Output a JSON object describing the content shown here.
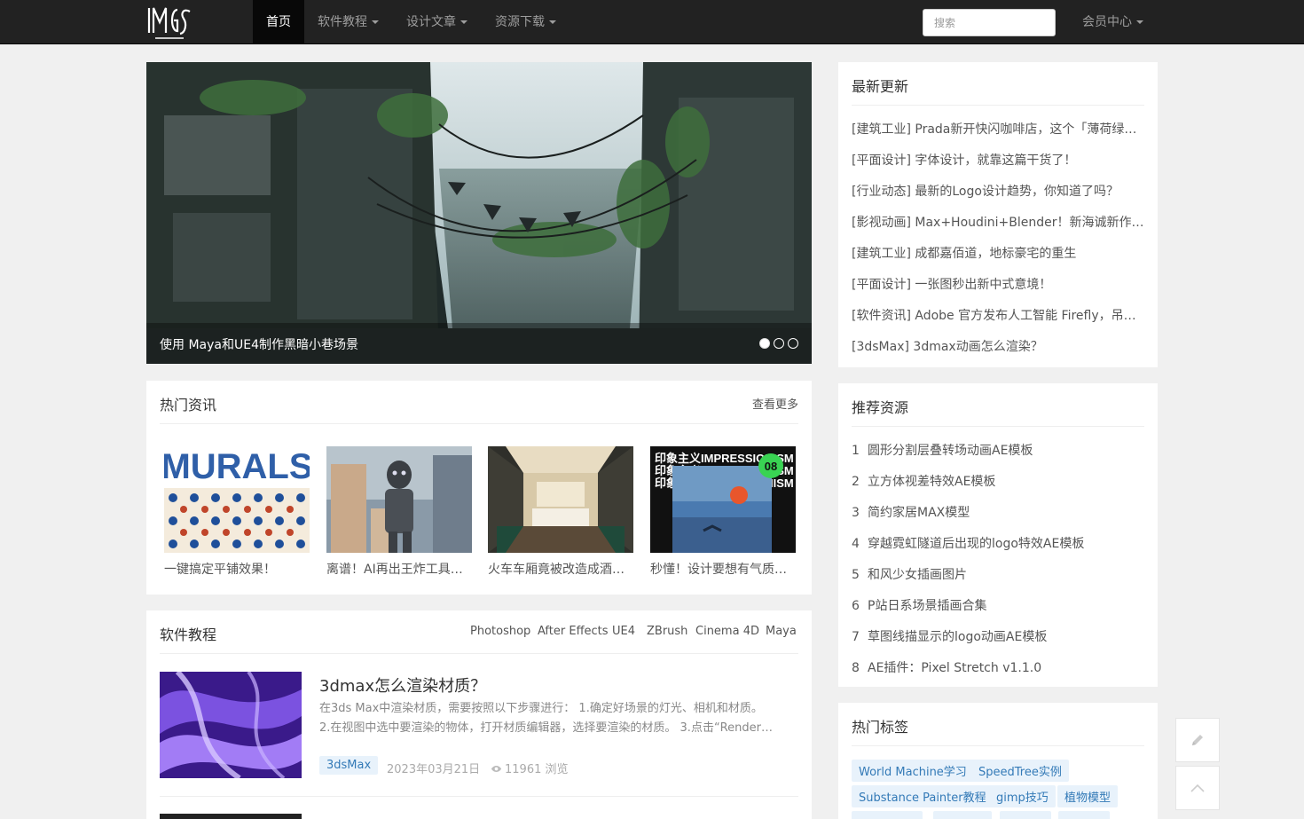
{
  "navbar": {
    "logo_text": "IMG",
    "items": [
      {
        "label": "首页",
        "dropdown": false,
        "active": true
      },
      {
        "label": "软件教程",
        "dropdown": true,
        "active": false
      },
      {
        "label": "设计文章",
        "dropdown": true,
        "active": false
      },
      {
        "label": "资源下载",
        "dropdown": true,
        "active": false
      }
    ],
    "search_placeholder": "搜索",
    "member_label": "会员中心"
  },
  "slider": {
    "caption": "使用 Maya和UE4制作黑暗小巷场景",
    "dots": 3,
    "active_dot": 0
  },
  "hot_news": {
    "title": "热门资讯",
    "more_label": "查看更多",
    "cards": [
      {
        "caption": "一键搞定平铺效果！",
        "thumb_text": "MURALS"
      },
      {
        "caption": "离谱！AI再出王炸工具…"
      },
      {
        "caption": "火车车厢竟被改造成酒…"
      },
      {
        "caption": "秒懂！设计要想有气质…",
        "thumb_text": "印象主义IMPRESSIONISM",
        "badge": "08"
      }
    ]
  },
  "software": {
    "title": "软件教程",
    "tabs": [
      "Photoshop",
      "After Effects",
      "UE4",
      "ZBrush",
      "Cinema 4D",
      "Maya"
    ],
    "article": {
      "title": "3dmax怎么渲染材质？",
      "excerpt_line1": "在3ds Max中渲染材质，需要按照以下步骤进行： 1.确定好场景的灯光、相机和材质。",
      "excerpt_line2": "2.在视图中选中要渲染的物体，打开材质编辑器，选择要渲染的材质。 3.点击“Render…",
      "tag": "3dsMax",
      "date": "2023年03月21日",
      "views": "11961 浏览"
    }
  },
  "latest": {
    "title": "最新更新",
    "items": [
      "[建筑工业] Prada新开快闪咖啡店，这个「薄荷绿」…",
      "[平面设计] 字体设计，就靠这篇干货了！",
      "[行业动态] 最新的Logo设计趋势，你知道了吗？",
      "[影视动画] Max+Houdini+Blender！新海诚新作《…",
      "[建筑工业] 成都嘉佰道，地标豪宅的重生",
      "[平面设计] 一张图秒出新中式意境！",
      "[软件资讯] Adobe 官方发布人工智能 Firefly，吊打…",
      "[3dsMax] 3dmax动画怎么渲染？"
    ]
  },
  "recommended": {
    "title": "推荐资源",
    "items": [
      {
        "rank": "1",
        "label": "圆形分割层叠转场动画AE模板"
      },
      {
        "rank": "2",
        "label": "立方体视差特效AE模板"
      },
      {
        "rank": "3",
        "label": "简约家居MAX模型"
      },
      {
        "rank": "4",
        "label": "穿越霓虹隧道后出现的logo特效AE模板"
      },
      {
        "rank": "5",
        "label": "和风少女插画图片"
      },
      {
        "rank": "6",
        "label": "P站日系场景插画合集"
      },
      {
        "rank": "7",
        "label": "草图线描显示的logo动画AE模板"
      },
      {
        "rank": "8",
        "label": "AE插件：Pixel Stretch v1.1.0"
      }
    ]
  },
  "tags": {
    "title": "热门标签",
    "rows": [
      [
        "World Machine学习",
        "SpeedTree实例"
      ],
      [
        "Substance Painter教程",
        "gimp技巧",
        "植物模型"
      ]
    ]
  },
  "colors": {
    "navbar_bg": "#222222",
    "link_blue": "#337ab7",
    "tag_bg": "#e8f2fb",
    "page_bg": "#f0f0f0"
  }
}
